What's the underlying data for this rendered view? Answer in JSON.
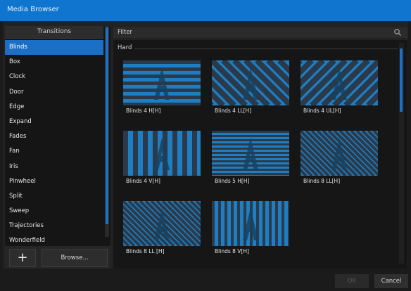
{
  "window": {
    "title": "Media Browser"
  },
  "left_panel": {
    "header": "Transitions",
    "items": [
      "Blinds",
      "Box",
      "Clock",
      "Door",
      "Edge",
      "Expand",
      "Fades",
      "Fan",
      "Iris",
      "Pinwheel",
      "Split",
      "Sweep",
      "Trajectories",
      "Wonderfield"
    ],
    "selected_index": 0,
    "add_label": "+",
    "browse_label": "Browse..."
  },
  "right_panel": {
    "filter_label": "Filter",
    "search_icon": "search-icon",
    "group_label": "Hard",
    "tiles": [
      {
        "caption": "Blinds 4 H[H]",
        "pattern": "horizontal"
      },
      {
        "caption": "Blinds 4 LL[H]",
        "pattern": "diag-left"
      },
      {
        "caption": "Blinds 4 UL[H]",
        "pattern": "diag-right"
      },
      {
        "caption": "Blinds 4 V[H]",
        "pattern": "vertical"
      },
      {
        "caption": "Blinds 5 H[H]",
        "pattern": "horizontal-fine"
      },
      {
        "caption": "Blinds 8 LL[H]",
        "pattern": "diag-fine"
      },
      {
        "caption": "Blinds 8 LL [H]",
        "pattern": "diag-fine2"
      },
      {
        "caption": "Blinds 8 V[H]",
        "pattern": "vertical-fine"
      }
    ]
  },
  "footer": {
    "ok_label": "OK",
    "cancel_label": "Cancel"
  },
  "colors": {
    "accent": "#1a6fc7",
    "stripe": "#1f7ec1",
    "dark": "#2a3a4a"
  }
}
